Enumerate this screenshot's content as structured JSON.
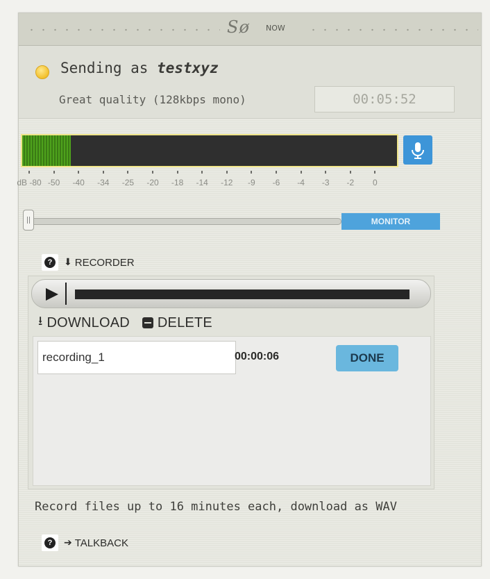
{
  "header": {
    "logo_text": "Sø",
    "logo_suffix": "NOW"
  },
  "status": {
    "sending_prefix": "Sending as",
    "username": "testxyz",
    "quality": "Great quality (128kbps mono)",
    "elapsed": "00:05:52",
    "led_color": "#f2c02c"
  },
  "meter": {
    "level_fraction": 0.13,
    "labels": [
      "dB -80",
      "-50",
      "-40",
      "-34",
      "-25",
      "-20",
      "-18",
      "-14",
      "-12",
      "-9",
      "-6",
      "-4",
      "-3",
      "-2",
      "0"
    ],
    "mic_icon": "microphone-icon"
  },
  "monitor": {
    "slider_value": 0,
    "button_label": "MONITOR"
  },
  "recorder": {
    "heading": "RECORDER",
    "download_label": "DOWNLOAD",
    "delete_label": "DELETE",
    "recording_name": "recording_1",
    "recording_duration": "00:00:06",
    "done_label": "DONE"
  },
  "footer": {
    "note": "Record files up to 16 minutes each, download as WAV",
    "talkback_label": "TALKBACK"
  },
  "colors": {
    "accent": "#3d95d8",
    "meter_green": "#4ea21c",
    "meter_border": "#efe58a"
  }
}
